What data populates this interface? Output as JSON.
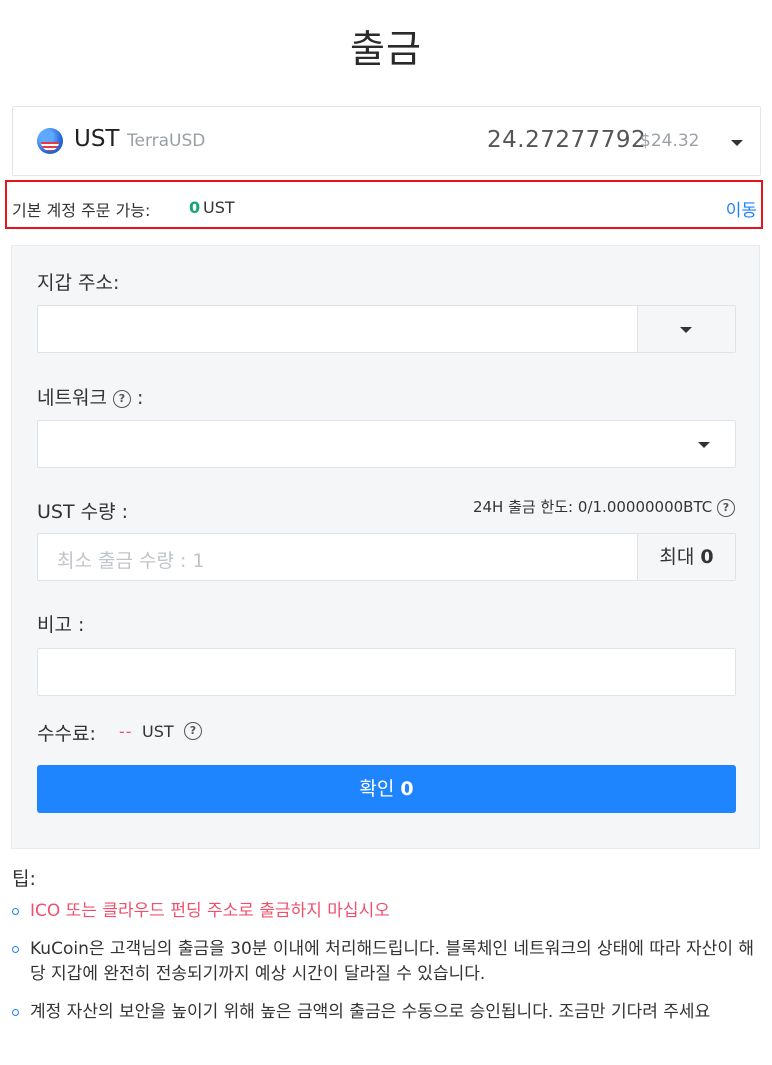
{
  "page": {
    "title": "출금"
  },
  "coin": {
    "symbol": "UST",
    "name": "TerraUSD",
    "balance": "24.27277792",
    "usd_value": "$24.32",
    "icon": "us-flag-icon"
  },
  "available": {
    "label": "기본 계정 주문 가능:",
    "amount": "0",
    "unit": "UST",
    "transfer_link": "이동"
  },
  "form": {
    "wallet_address_label": "지갑 주소:",
    "network_label": "네트워크",
    "network_colon": ":",
    "amount_label": "UST 수량 :",
    "limit_label": "24H 출금 한도:",
    "limit_value": "0/1.00000000BTC",
    "amount_placeholder": "최소 출금 수량 : 1",
    "max_button": "최대",
    "max_value": "0",
    "remark_label": "비고 :",
    "fee_label": "수수료:",
    "fee_value": "--",
    "fee_unit": "UST",
    "confirm_button": "확인",
    "confirm_value": "0"
  },
  "tips": {
    "title": "팁:",
    "items": [
      "ICO 또는 클라우드 펀딩 주소로 출금하지 마십시오",
      "KuCoin은 고객님의 출금을 30분 이내에 처리해드립니다. 블록체인 네트워크의 상태에 따라 자산이 해당 지갑에 완전히 전송되기까지 예상 시간이 달라질 수 있습니다.",
      "계정 자산의 보안을 높이기 위해 높은 금액의 출금은 수동으로 승인됩니다. 조금만 기다려 주세요"
    ]
  },
  "colors": {
    "accent": "#1e85ff",
    "available_amount": "#17a673",
    "warning_text": "#f0506e",
    "highlight_border": "#e3151a"
  }
}
